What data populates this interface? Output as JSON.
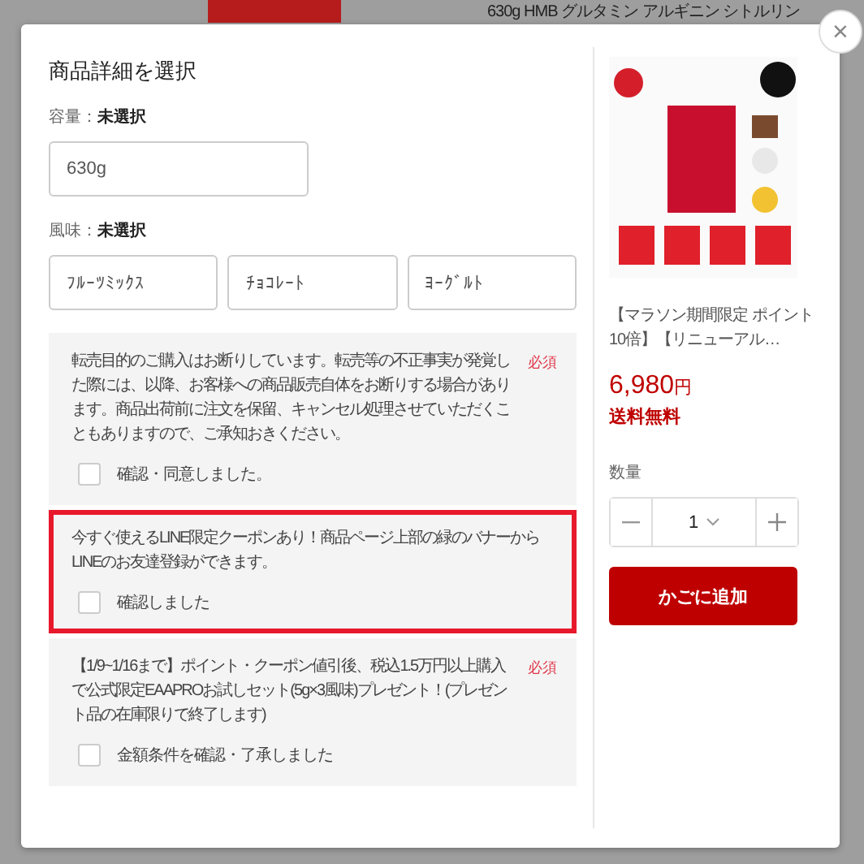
{
  "background": {
    "title": "630g HMB グルタミン アルギニン シトルリン"
  },
  "modal": {
    "title": "商品詳細を選択",
    "close": "×"
  },
  "options": [
    {
      "label": "容量：",
      "value": "未選択",
      "choices": [
        {
          "label": "630g",
          "selected": false
        }
      ]
    },
    {
      "label": "風味：",
      "value": "未選択",
      "choices": [
        {
          "label": "ﾌﾙｰﾂﾐｯｸｽ",
          "selected": false
        },
        {
          "label": "ﾁｮｺﾚｰﾄ",
          "selected": false
        },
        {
          "label": "ﾖｰｸﾞﾙﾄ",
          "selected": false
        }
      ]
    }
  ],
  "notices": [
    {
      "text": "転売目的のご購入はお断りしています。転売等の不正事実が発覚した際には、以降、お客様への商品販売自体をお断りする場合があります。商品出荷前に注文を保留、キャンセル処理させていただくこともありますので、ご承知おきください。",
      "required": "必須",
      "highlighted": false,
      "checkbox": {
        "label": "確認・同意しました。",
        "checked": false
      }
    },
    {
      "text": "今すぐ使えるLINE限定クーポンあり！商品ページ上部の緑のバナーからLINEのお友達登録ができます。",
      "highlighted": true,
      "checkbox": {
        "label": "確認しました",
        "checked": false
      }
    },
    {
      "text": "【1/9~1/16まで】ポイント・クーポン値引後、税込1.5万円以上購入で公式限定EAAPROお試しセット(5g×3風味)プレゼント！(プレゼント品の在庫限りで終了します)",
      "required": "必須",
      "highlighted": false,
      "checkbox": {
        "label": "金額条件を確認・了承しました",
        "checked": false
      }
    }
  ],
  "product": {
    "name": "【マラソン期間限定 ポイント10倍】【リニューアル…",
    "price": "6,980",
    "currency": "円",
    "shipping": "送料無料"
  },
  "quantity": {
    "label": "数量",
    "value": "1"
  },
  "add_to_cart": "かごに追加"
}
